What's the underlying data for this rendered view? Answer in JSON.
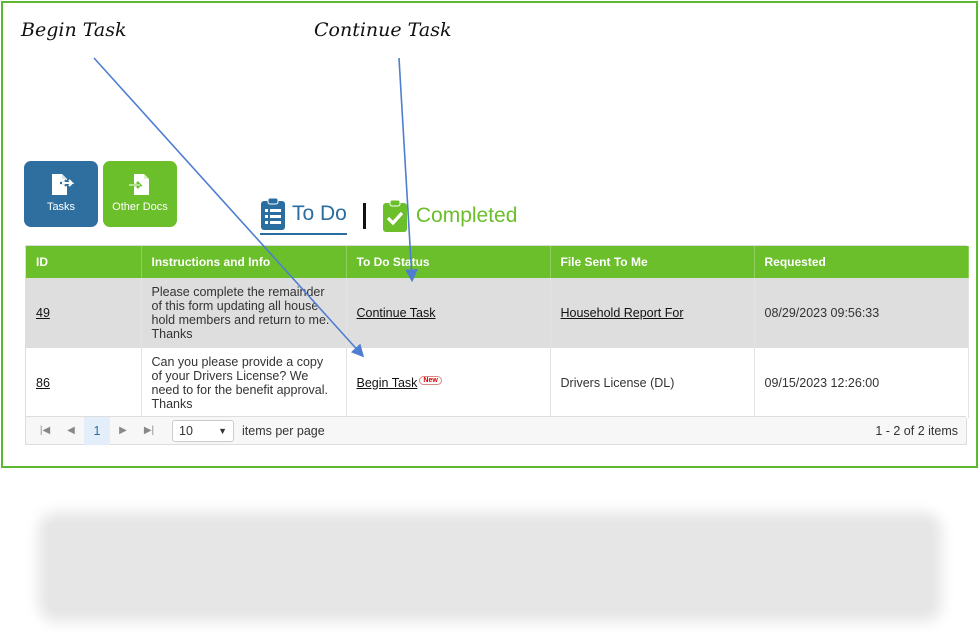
{
  "annotations": {
    "begin": "Begin Task",
    "continue": "Continue Task"
  },
  "tiles": [
    {
      "label": "Tasks",
      "icon": "file-export-icon"
    },
    {
      "label": "Other Docs",
      "icon": "file-import-icon"
    }
  ],
  "tabs": {
    "todo": "To Do",
    "completed": "Completed"
  },
  "table": {
    "headers": [
      "ID",
      "Instructions and Info",
      "To Do Status",
      "File Sent To Me",
      "Requested"
    ],
    "rows": [
      {
        "id": "49",
        "instructions": "Please complete the remainder of this form updating all house hold members and return to me. Thanks",
        "status": "Continue Task",
        "file": "Household Report For",
        "requested": "08/29/2023 09:56:33"
      },
      {
        "id": "86",
        "instructions": "Can you please provide a copy of your Drivers License? We need to for the benefit approval. Thanks",
        "status": "Begin Task",
        "badge": "New",
        "file": "Drivers License (DL)",
        "requested": "09/15/2023 12:26:00"
      }
    ]
  },
  "pager": {
    "page": "1",
    "page_size": "10",
    "per_page_label": "items per page",
    "summary": "1 - 2 of 2 items"
  },
  "colors": {
    "green": "#6bbf2a",
    "blue": "#2f6f9f",
    "arrow": "#4f7ed0"
  }
}
